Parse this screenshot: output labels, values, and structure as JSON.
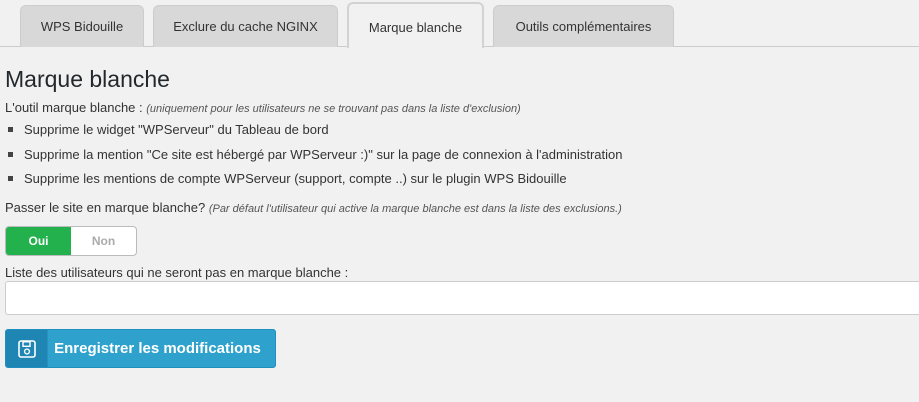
{
  "tabs": [
    {
      "label": "WPS Bidouille"
    },
    {
      "label": "Exclure du cache NGINX"
    },
    {
      "label": "Marque blanche"
    },
    {
      "label": "Outils complémentaires"
    }
  ],
  "page": {
    "title": "Marque blanche",
    "intro_label": "L'outil marque blanche :",
    "intro_note": "(uniquement pour les utilisateurs ne se trouvant pas dans la liste d'exclusion)",
    "features": [
      "Supprime le widget \"WPServeur\" du Tableau de bord",
      "Supprime la mention \"Ce site est hébergé par WPServeur :)\" sur la page de connexion à l'administration",
      "Supprime les mentions de compte WPServeur (support, compte ..) sur le plugin WPS Bidouille"
    ],
    "question_label": "Passer le site en marque blanche?",
    "question_note": "(Par défaut l'utilisateur qui active la marque blanche est dans la liste des exclusions.)"
  },
  "toggle": {
    "on_label": "Oui",
    "off_label": "Non",
    "selected": "Oui",
    "on_color": "#22b14c"
  },
  "exclusion_list": {
    "label": "Liste des utilisateurs qui ne seront pas en marque blanche :",
    "value": ""
  },
  "save_button": {
    "label": "Enregistrer les modifications",
    "icon": "floppy-disk-icon",
    "color": "#2ea2cc"
  }
}
